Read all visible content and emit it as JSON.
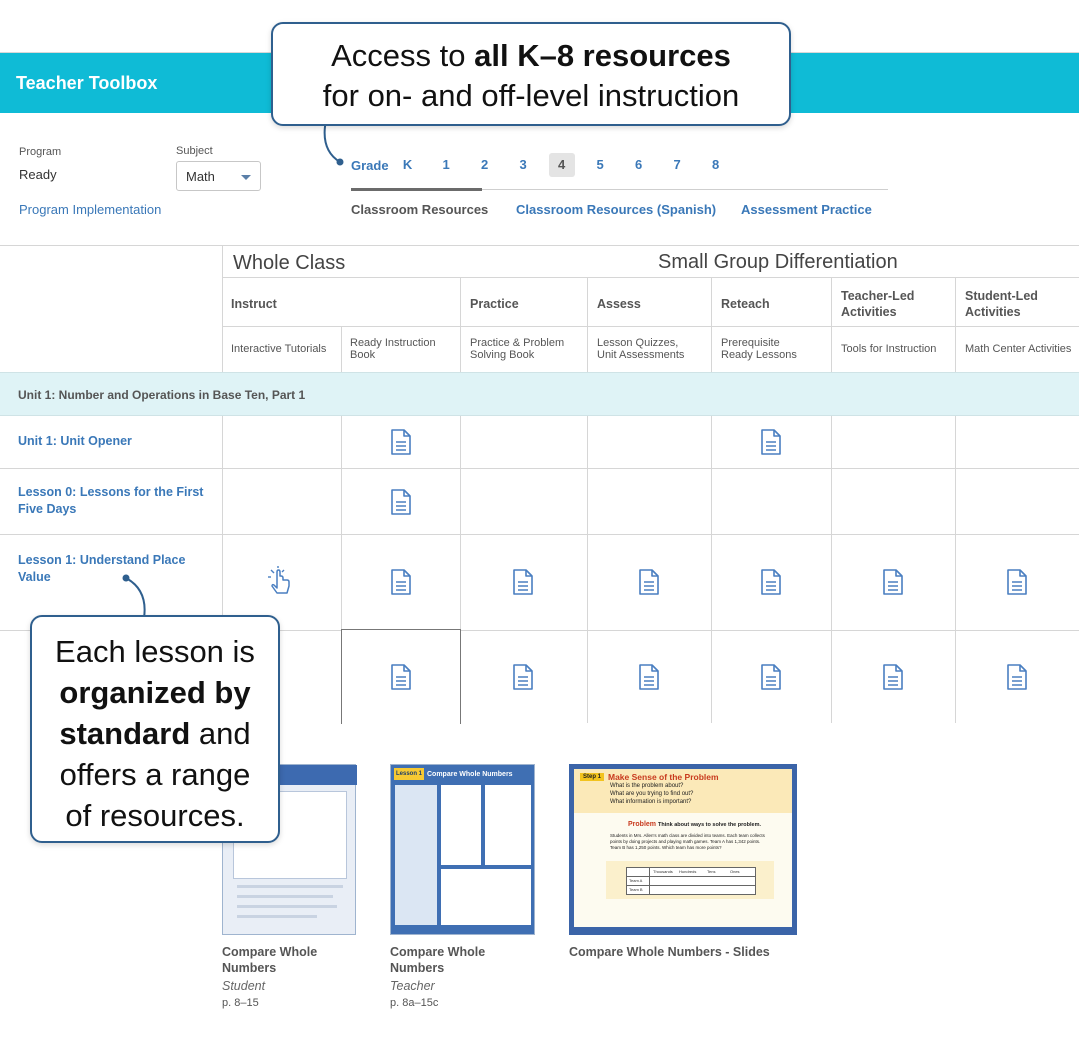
{
  "app": {
    "title": "Teacher Toolbox"
  },
  "controls": {
    "program_label": "Program",
    "program_value": "Ready",
    "subject_label": "Subject",
    "subject_value": "Math",
    "program_link": "Program Implementation",
    "grade_label": "Grade",
    "grades": [
      "K",
      "1",
      "2",
      "3",
      "4",
      "5",
      "6",
      "7",
      "8"
    ],
    "active_grade": "4",
    "tabs": [
      "Classroom Resources",
      "Classroom Resources (Spanish)",
      "Assessment Practice"
    ],
    "active_tab": "Classroom Resources"
  },
  "table": {
    "group_whole_class": "Whole Class",
    "group_small_group": "Small Group Differentiation",
    "columns": [
      {
        "head": "Instruct",
        "sub": "Interactive Tutorials"
      },
      {
        "head": "",
        "sub": "Ready Instruction Book"
      },
      {
        "head": "Practice",
        "sub": "Practice & Problem Solving Book"
      },
      {
        "head": "Assess",
        "sub": "Lesson Quizzes, Unit Assessments"
      },
      {
        "head": "Reteach",
        "sub": "Prerequisite Ready Lessons"
      },
      {
        "head": "Teacher-Led Activities",
        "sub": "Tools for Instruction"
      },
      {
        "head": "Student-Led Activities",
        "sub": "Math Center Activities"
      }
    ],
    "unit_band": "Unit 1: Number and Operations in Base Ten, Part 1",
    "rows": [
      {
        "label": "Unit 1: Unit Opener"
      },
      {
        "label": "Lesson 0: Lessons for the First Five Days"
      },
      {
        "label": "Lesson 1: Understand Place Value"
      },
      {
        "label": "Le… Nu…"
      }
    ],
    "icon_document": "document-icon",
    "icon_tap": "tap-hand-icon"
  },
  "preview": {
    "items": [
      {
        "title": "Compare Whole Numbers",
        "type": "Student",
        "pages": "p. 8–15"
      },
      {
        "title": "Compare Whole Numbers",
        "type": "Teacher",
        "pages": "p. 8a–15c"
      },
      {
        "title": "Compare Whole Numbers - Slides",
        "type": "",
        "pages": ""
      }
    ],
    "slide_heading": "Make Sense of the Problem",
    "slide_step": "Step 1",
    "slide_bullets": [
      "What is the problem about?",
      "What are you trying to find out?",
      "What information is important?"
    ],
    "slide_problem_label": "Problem",
    "slide_problem_title": "Think about ways to solve the problem.",
    "slide_problem_text": "Students in Mrs. Allen's math class are divided into teams. Each team collects points by doing projects and playing math games. Team A has 1,342 points. Team B has 1,250 points. Which team has more points?",
    "slide_table_headers": [
      "Thousands",
      "Hundreds",
      "Tens",
      "Ones"
    ],
    "slide_table_rows": [
      "Team A",
      "Team B"
    ],
    "teacher_banner": "Lesson 1",
    "teacher_title": "Compare Whole Numbers"
  },
  "callouts": {
    "top_line1_plain": "Access to ",
    "top_line1_bold": "all K–8 resources",
    "top_line2": "for on- and off-level instruction",
    "left_plain1": "Each lesson is",
    "left_bold1": "organized by",
    "left_bold2": "standard",
    "left_plain2": " and",
    "left_plain3": "offers a range",
    "left_plain4": "of resources."
  },
  "colors": {
    "topbar": "#0fbbd6",
    "link": "#3a78b8",
    "unit_band": "#dff3f6",
    "callout_border": "#2f5f8e"
  }
}
